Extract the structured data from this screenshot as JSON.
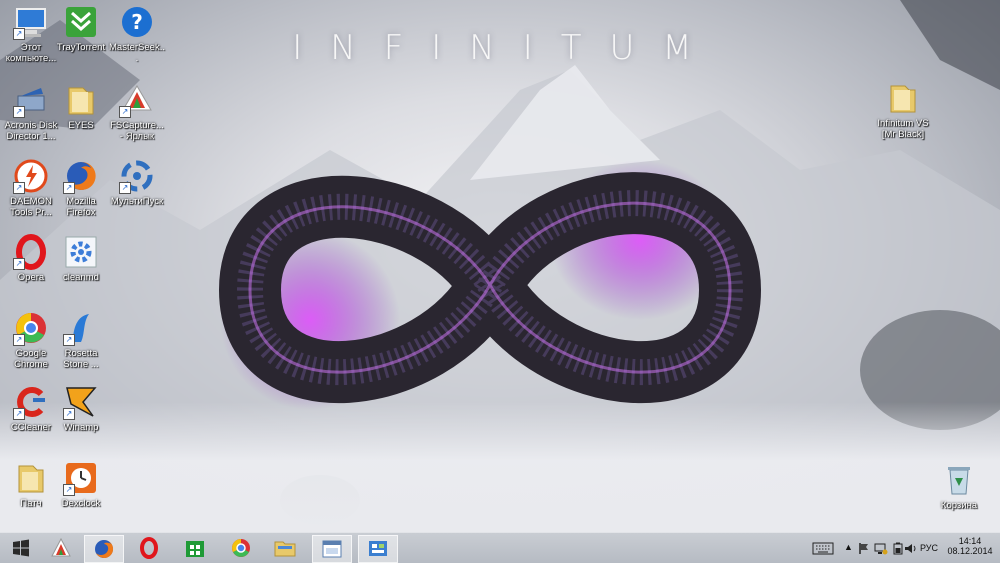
{
  "wallpaper": {
    "title": "INFINITUM"
  },
  "desktop_icons": [
    {
      "id": "this-pc",
      "label": "Этот компьюте...",
      "icon": "computer-icon"
    },
    {
      "id": "traytorrent",
      "label": "TrayTorrent",
      "icon": "traytorrent-icon"
    },
    {
      "id": "mastersecker",
      "label": "MasterSeek...",
      "icon": "help-icon"
    },
    {
      "id": "acronis",
      "label": "Acronis Disk Director 1...",
      "icon": "acronis-icon"
    },
    {
      "id": "eyes",
      "label": "EYES",
      "icon": "folder-icon"
    },
    {
      "id": "fscapture",
      "label": "FSCapture... - Ярлык",
      "icon": "fscapture-icon"
    },
    {
      "id": "daemon",
      "label": "DAEMON Tools Pr...",
      "icon": "daemon-tools-icon"
    },
    {
      "id": "firefox",
      "label": "Mozilla Firefox",
      "icon": "firefox-icon"
    },
    {
      "id": "multipusk",
      "label": "МультиПуск",
      "icon": "multipusk-icon"
    },
    {
      "id": "opera",
      "label": "Opera",
      "icon": "opera-icon"
    },
    {
      "id": "cleanmd",
      "label": "cleanmd",
      "icon": "gear-icon"
    },
    {
      "id": "chrome",
      "label": "Google Chrome",
      "icon": "chrome-icon"
    },
    {
      "id": "rosetta",
      "label": "Rosetta Stone ...",
      "icon": "rosetta-icon"
    },
    {
      "id": "ccleaner",
      "label": "CCleaner",
      "icon": "ccleaner-icon"
    },
    {
      "id": "winamp",
      "label": "Winamp",
      "icon": "winamp-icon"
    },
    {
      "id": "patch",
      "label": "Патч",
      "icon": "folder-icon"
    },
    {
      "id": "dexclock",
      "label": "Dexclock",
      "icon": "clock-icon"
    },
    {
      "id": "infinitum-folder",
      "label": "Infinitum VS [Mr Black]",
      "icon": "folder-icon"
    },
    {
      "id": "recycle-bin",
      "label": "Корзина",
      "icon": "recycle-bin-icon"
    }
  ],
  "taskbar": {
    "buttons": [
      "start-icon",
      "fscapture-icon",
      "firefox-icon",
      "opera-icon",
      "store-icon",
      "chrome-icon",
      "file-explorer-icon",
      "window-app-icon",
      "control-panel-icon"
    ],
    "tray": {
      "language": "РУС",
      "time": "14:14",
      "date": "08.12.2014"
    }
  }
}
